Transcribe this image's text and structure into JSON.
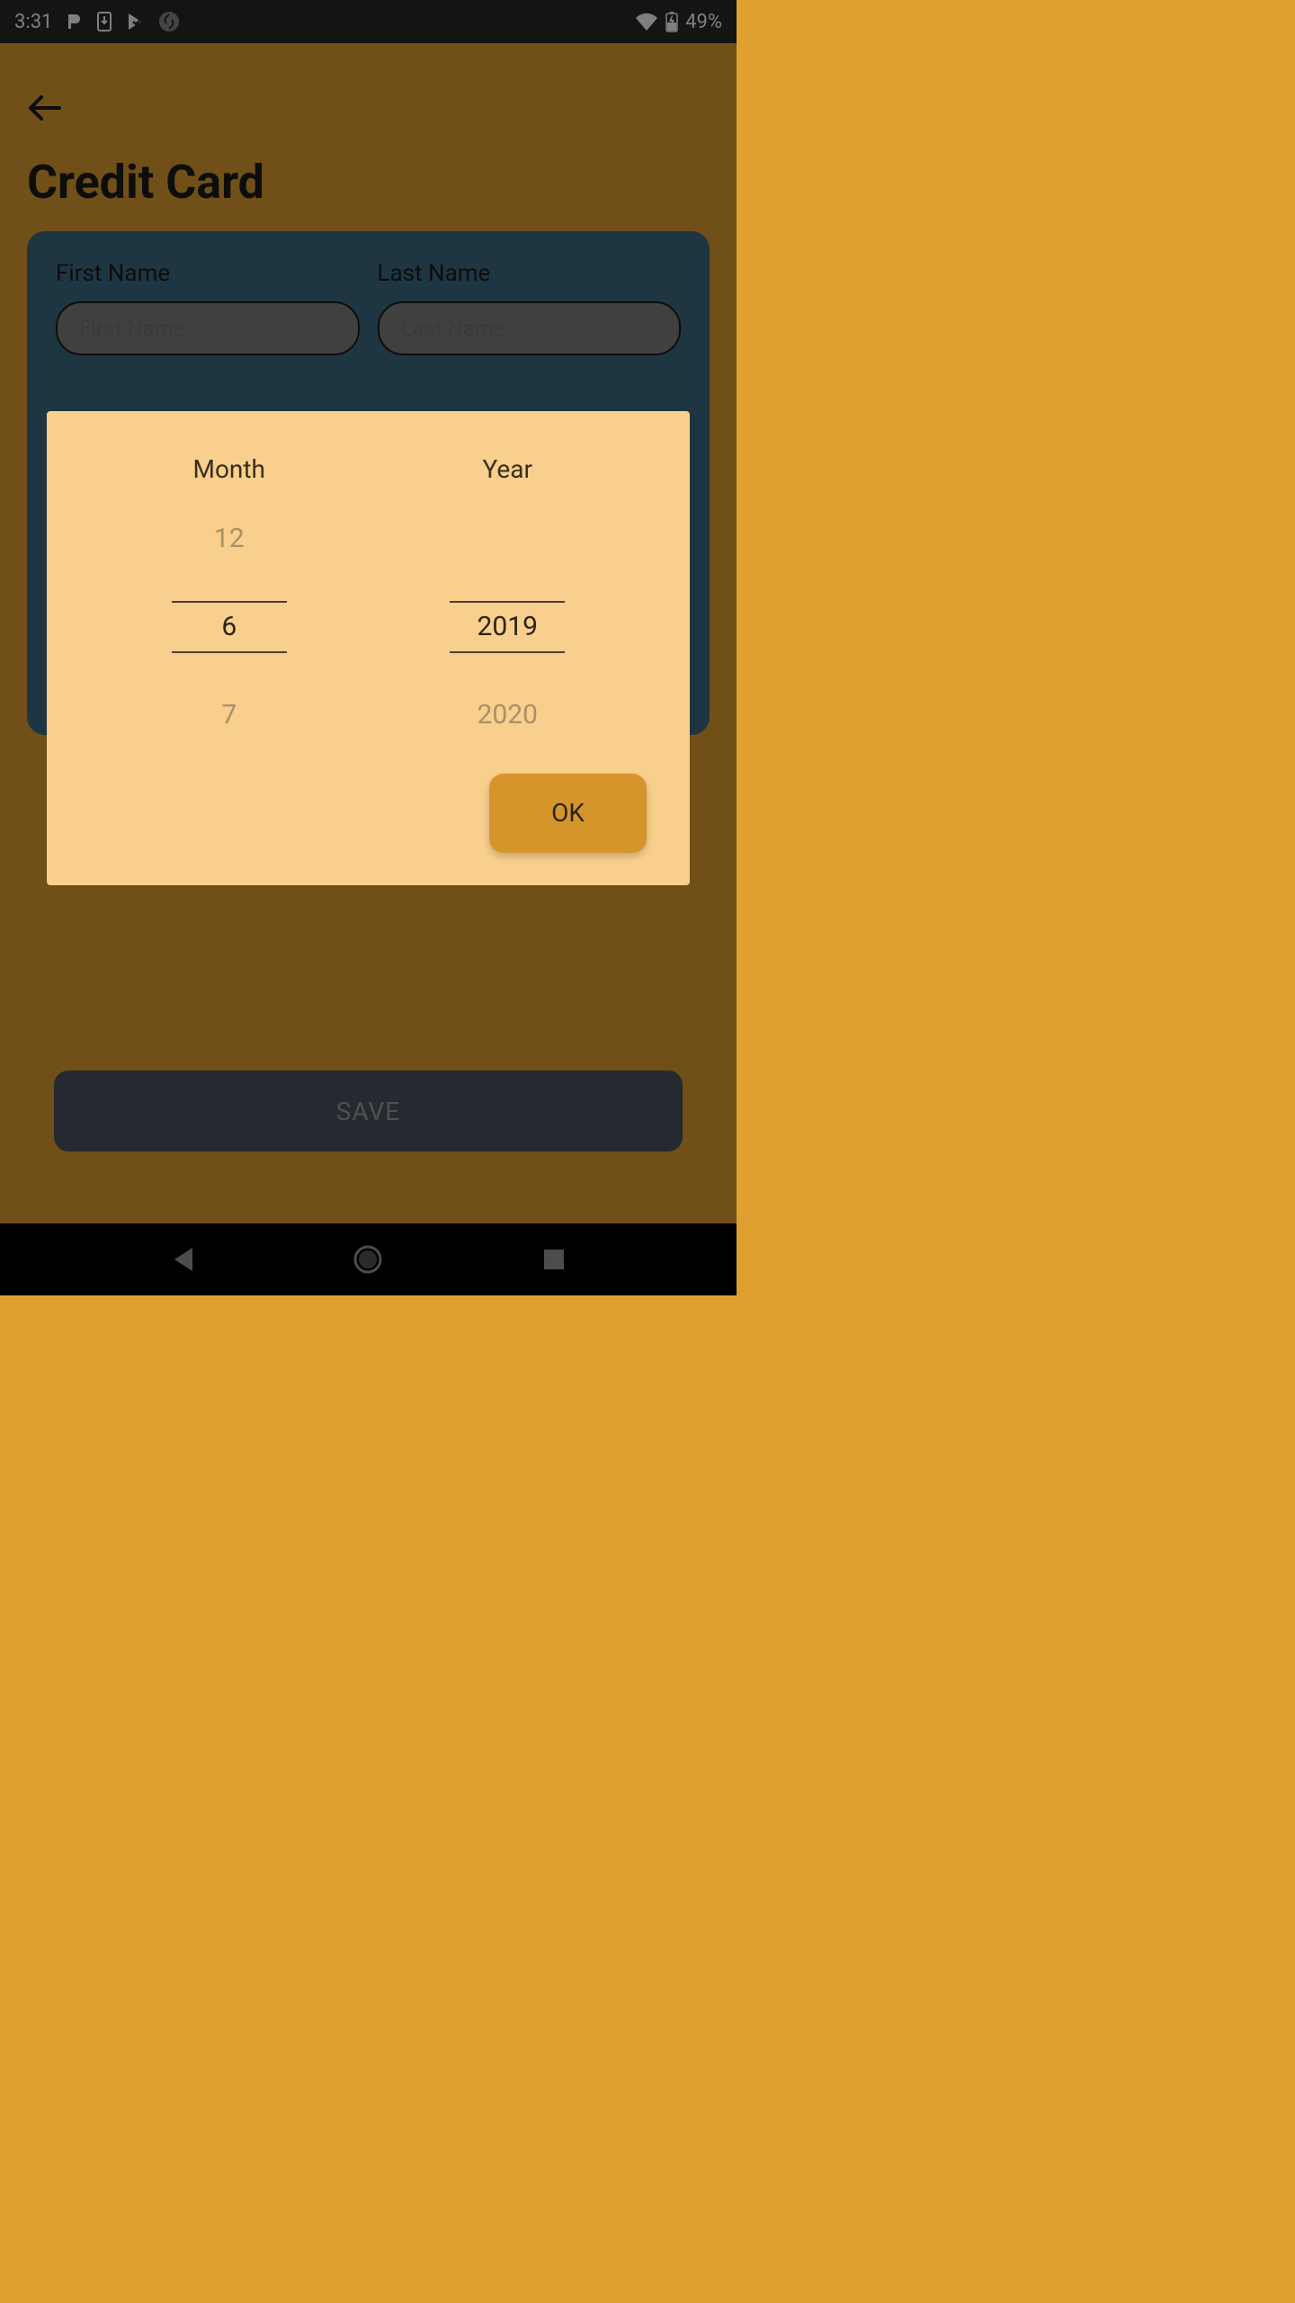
{
  "status_bar": {
    "time": "3:31",
    "battery_percent": "49%"
  },
  "page": {
    "title": "Credit Card",
    "first_name_label": "First Name",
    "first_name_placeholder": "First Name",
    "last_name_label": "Last Name",
    "last_name_placeholder": "Last Name",
    "save_button": "SAVE"
  },
  "dialog": {
    "month_label": "Month",
    "year_label": "Year",
    "month_prev": "12",
    "month_selected": "6",
    "month_next": "7",
    "year_prev": "",
    "year_selected": "2019",
    "year_next": "2020",
    "ok_button": "OK"
  }
}
